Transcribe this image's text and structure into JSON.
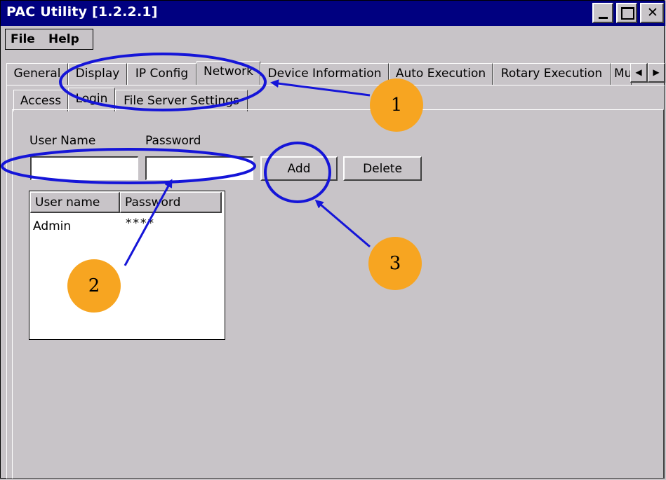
{
  "window": {
    "title": "PAC Utility  [1.2.2.1]"
  },
  "menu": {
    "file": "File",
    "help": "Help"
  },
  "tabs": [
    {
      "label": "General"
    },
    {
      "label": "Display"
    },
    {
      "label": "IP Config"
    },
    {
      "label": "Network"
    },
    {
      "label": "Device Information"
    },
    {
      "label": "Auto Execution"
    },
    {
      "label": "Rotary Execution"
    },
    {
      "label": "Mu"
    }
  ],
  "subtabs": [
    {
      "label": "Access"
    },
    {
      "label": "Login"
    },
    {
      "label": "File Server Settings"
    }
  ],
  "form": {
    "user_name_label": "User Name",
    "password_label": "Password",
    "user_name_value": "",
    "password_value": "",
    "add_label": "Add",
    "delete_label": "Delete"
  },
  "list": {
    "columns": [
      "User name",
      "Password"
    ],
    "rows": [
      {
        "user": "Admin",
        "password": "****"
      }
    ]
  },
  "annotations": {
    "badge1": "1",
    "badge2": "2",
    "badge3": "3"
  },
  "colors": {
    "titlebar": "#000080",
    "annotation": "#1515d8",
    "badge": "#f7a521"
  }
}
